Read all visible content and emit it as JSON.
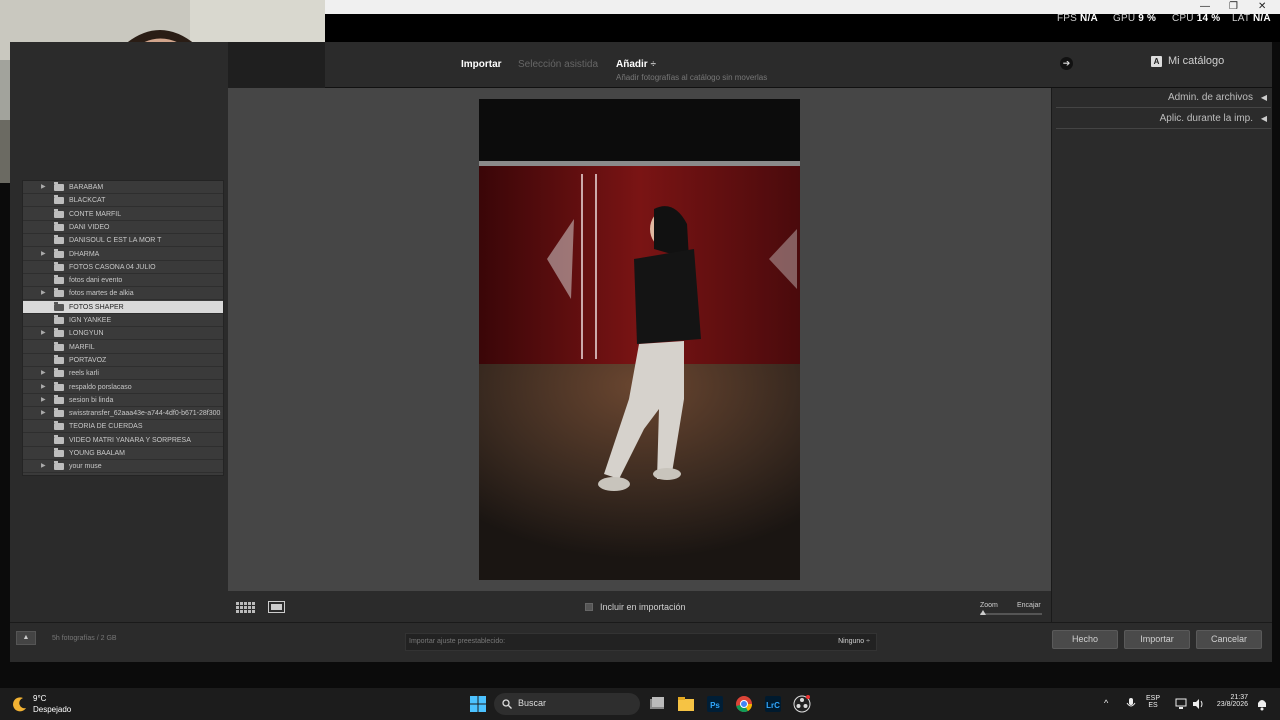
{
  "overlay": {
    "fps_label": "FPS",
    "fps_value": "N/A",
    "gpu_label": "GPU",
    "gpu_value": "9 %",
    "cpu_label": "CPU",
    "cpu_value": "14 %",
    "lat_label": "LAT",
    "lat_value": "N/A"
  },
  "header": {
    "tab_import": "Importar",
    "tab_selection": "Selección asistida",
    "add_label": "Añadir",
    "add_caret": "÷",
    "add_subtitle": "Añadir fotografías al catálogo sin moverlas",
    "catalog_icon": "A",
    "catalog_label": "Mi catálogo"
  },
  "folders": [
    {
      "label": "BARABAM",
      "expandable": true
    },
    {
      "label": "BLACKCAT",
      "expandable": false
    },
    {
      "label": "CONTE MARFIL",
      "expandable": false
    },
    {
      "label": "DANI VIDEO",
      "expandable": false
    },
    {
      "label": "DANISOUL C EST LA MOR T",
      "expandable": false
    },
    {
      "label": "DHARMA",
      "expandable": true
    },
    {
      "label": "FOTOS CASONA 04 JULIO",
      "expandable": false
    },
    {
      "label": "fotos dani evento",
      "expandable": false
    },
    {
      "label": "fotos martes de alkia",
      "expandable": true
    },
    {
      "label": "FOTOS SHAPER",
      "expandable": false,
      "selected": true
    },
    {
      "label": "IGN YANKEE",
      "expandable": false
    },
    {
      "label": "LONGYUN",
      "expandable": true
    },
    {
      "label": "MARFIL",
      "expandable": false
    },
    {
      "label": "PORTAVOZ",
      "expandable": false
    },
    {
      "label": "reels karli",
      "expandable": true
    },
    {
      "label": "respaldo porslacaso",
      "expandable": true
    },
    {
      "label": "sesion bi linda",
      "expandable": true
    },
    {
      "label": "swisstransfer_62aaa43e-a744-4df0-b671-28f3001...",
      "expandable": true
    },
    {
      "label": "TEORIA DE CUERDAS",
      "expandable": false
    },
    {
      "label": "VIDEO MATRI YANARA Y SORPRESA",
      "expandable": false
    },
    {
      "label": "YOUNG BAALAM",
      "expandable": false
    },
    {
      "label": "your muse",
      "expandable": true
    }
  ],
  "right_panel": {
    "file_handling": "Admin. de archivos",
    "apply_during": "Aplic. durante la imp.",
    "caret": "◀"
  },
  "toolbar": {
    "include_label": "Incluir en importación",
    "zoom_label": "Zoom",
    "fit_label": "Encajar"
  },
  "bottom": {
    "expand_caret": "▲",
    "count_label": "5h fotografías / 2 GB",
    "preset_label": "Importar ajuste preestablecido:",
    "preset_value": "Ninguno ÷",
    "done": "Hecho",
    "import": "Importar",
    "cancel": "Cancelar"
  },
  "taskbar": {
    "temp": "9°C",
    "weather": "Despejado",
    "search": "Buscar",
    "lang_top": "ESP",
    "lang_bottom": "ES",
    "time": "21:37",
    "date": "23/8/2026"
  },
  "colors": {
    "panel": "#2b2b2b",
    "center": "#464646",
    "accent_red": "#7a1414"
  }
}
